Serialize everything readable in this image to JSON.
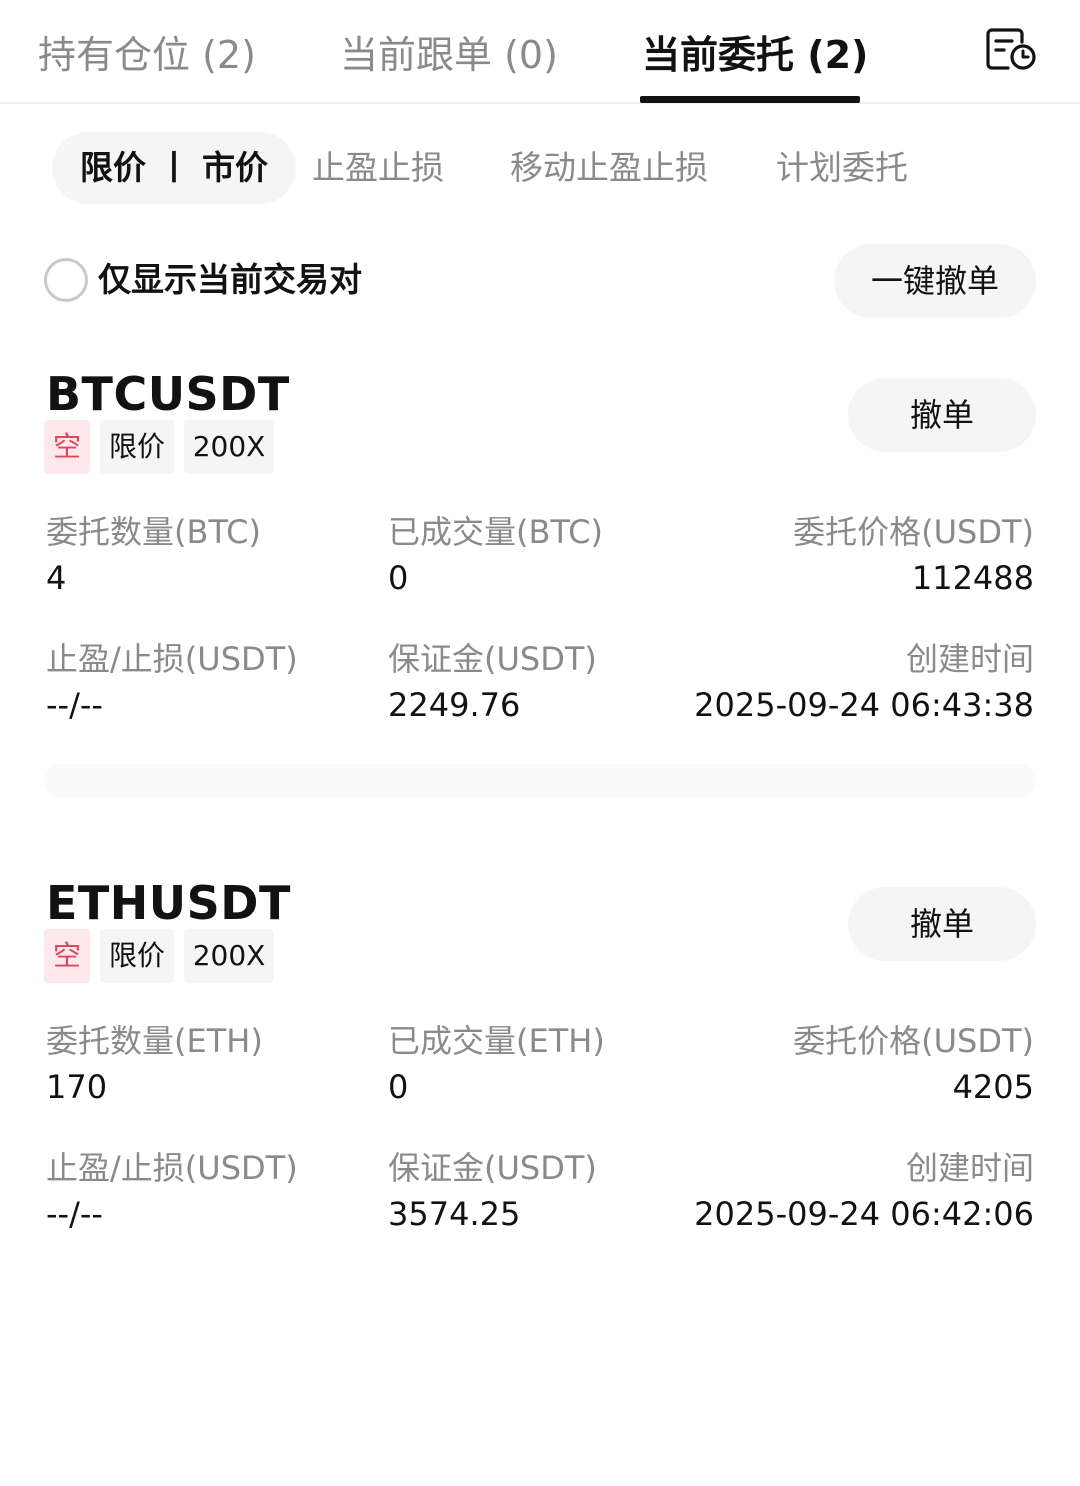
{
  "top_tabs": [
    {
      "label": "持有仓位 (2)"
    },
    {
      "label": "当前跟单 (0)"
    },
    {
      "label": "当前委托 (2)"
    }
  ],
  "sub_tabs": [
    {
      "label": "限价 丨 市价"
    },
    {
      "label": "止盈止损"
    },
    {
      "label": "移动止盈止损"
    },
    {
      "label": "计划委托"
    }
  ],
  "filter": {
    "label": "仅显示当前交易对",
    "cancel_all_label": "一键撤单"
  },
  "orders": [
    {
      "symbol": "BTCUSDT",
      "cancel_label": "撤单",
      "side": "空",
      "order_type": "限价",
      "leverage": "200X",
      "fields": {
        "qty_label": "委托数量(BTC)",
        "qty_value": "4",
        "filled_label": "已成交量(BTC)",
        "filled_value": "0",
        "price_label": "委托价格(USDT)",
        "price_value": "112488",
        "tpsl_label": "止盈/止损(USDT)",
        "tpsl_value": "--/--",
        "margin_label": "保证金(USDT)",
        "margin_value": "2249.76",
        "time_label": "创建时间",
        "time_value": "2025-09-24 06:43:38"
      }
    },
    {
      "symbol": "ETHUSDT",
      "cancel_label": "撤单",
      "side": "空",
      "order_type": "限价",
      "leverage": "200X",
      "fields": {
        "qty_label": "委托数量(ETH)",
        "qty_value": "170",
        "filled_label": "已成交量(ETH)",
        "filled_value": "0",
        "price_label": "委托价格(USDT)",
        "price_value": "4205",
        "tpsl_label": "止盈/止损(USDT)",
        "tpsl_value": "--/--",
        "margin_label": "保证金(USDT)",
        "margin_value": "3574.25",
        "time_label": "创建时间",
        "time_value": "2025-09-24 06:42:06"
      }
    }
  ],
  "colors": {
    "short_tag_text": "#e0455e",
    "short_tag_bg": "#fde9ec",
    "muted_text": "#8a8a8a",
    "primary_text": "#121212"
  },
  "icons": {
    "history": "order-history-icon"
  }
}
